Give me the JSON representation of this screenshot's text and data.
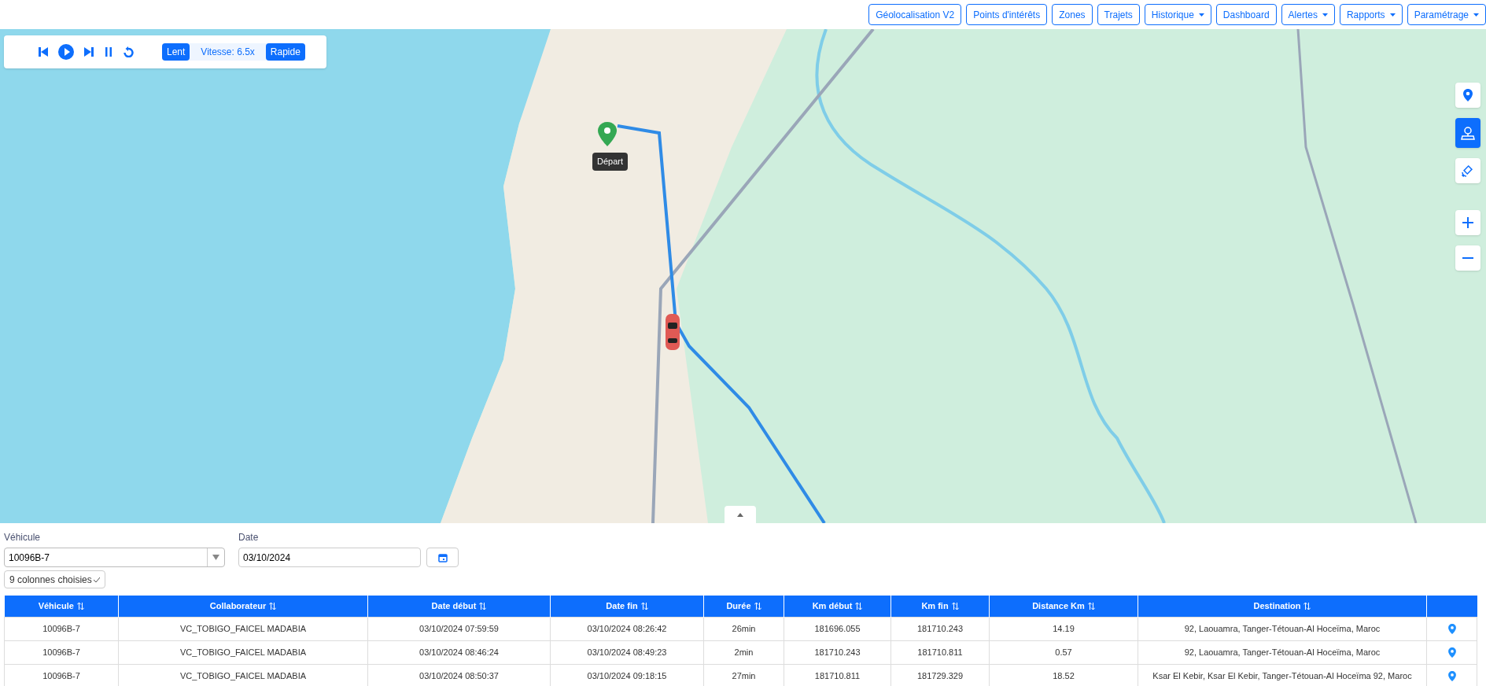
{
  "nav": [
    {
      "label": "Géolocalisation V2",
      "dropdown": false
    },
    {
      "label": "Points d'intérêts",
      "dropdown": false
    },
    {
      "label": "Zones",
      "dropdown": false
    },
    {
      "label": "Trajets",
      "dropdown": false
    },
    {
      "label": "Historique",
      "dropdown": true
    },
    {
      "label": "Dashboard",
      "dropdown": false
    },
    {
      "label": "Alertes",
      "dropdown": true
    },
    {
      "label": "Rapports",
      "dropdown": true
    },
    {
      "label": "Paramétrage",
      "dropdown": true
    }
  ],
  "player": {
    "slow": "Lent",
    "speed": "Vitesse: 6.5x",
    "fast": "Rapide"
  },
  "map": {
    "start_label": "Départ",
    "side_buttons": [
      {
        "kind": "pin",
        "selected": false
      },
      {
        "kind": "map",
        "selected": true
      },
      {
        "kind": "satellite",
        "selected": false
      }
    ]
  },
  "filters": {
    "vehicle_label": "Véhicule",
    "vehicle_value": "10096B-7",
    "date_label": "Date",
    "date_value": "03/10/2024",
    "columns_select": "9 colonnes choisies"
  },
  "table": {
    "columns": [
      "Véhicule",
      "Collaborateur",
      "Date début",
      "Date fin",
      "Durée",
      "Km début",
      "Km fin",
      "Distance Km",
      "Destination"
    ],
    "rows": [
      [
        "10096B-7",
        "VC_TOBIGO_FAICEL MADABIA",
        "03/10/2024 07:59:59",
        "03/10/2024 08:26:42",
        "26min",
        "181696.055",
        "181710.243",
        "14.19",
        "92, Laouamra, Tanger-Tétouan-Al Hoceïma, Maroc"
      ],
      [
        "10096B-7",
        "VC_TOBIGO_FAICEL MADABIA",
        "03/10/2024 08:46:24",
        "03/10/2024 08:49:23",
        "2min",
        "181710.243",
        "181710.811",
        "0.57",
        "92, Laouamra, Tanger-Tétouan-Al Hoceïma, Maroc"
      ],
      [
        "10096B-7",
        "VC_TOBIGO_FAICEL MADABIA",
        "03/10/2024 08:50:37",
        "03/10/2024 09:18:15",
        "27min",
        "181710.811",
        "181729.329",
        "18.52",
        "Ksar El Kebir, Ksar El Kebir, Tanger-Tétouan-Al Hoceïma 92, Maroc"
      ]
    ]
  }
}
